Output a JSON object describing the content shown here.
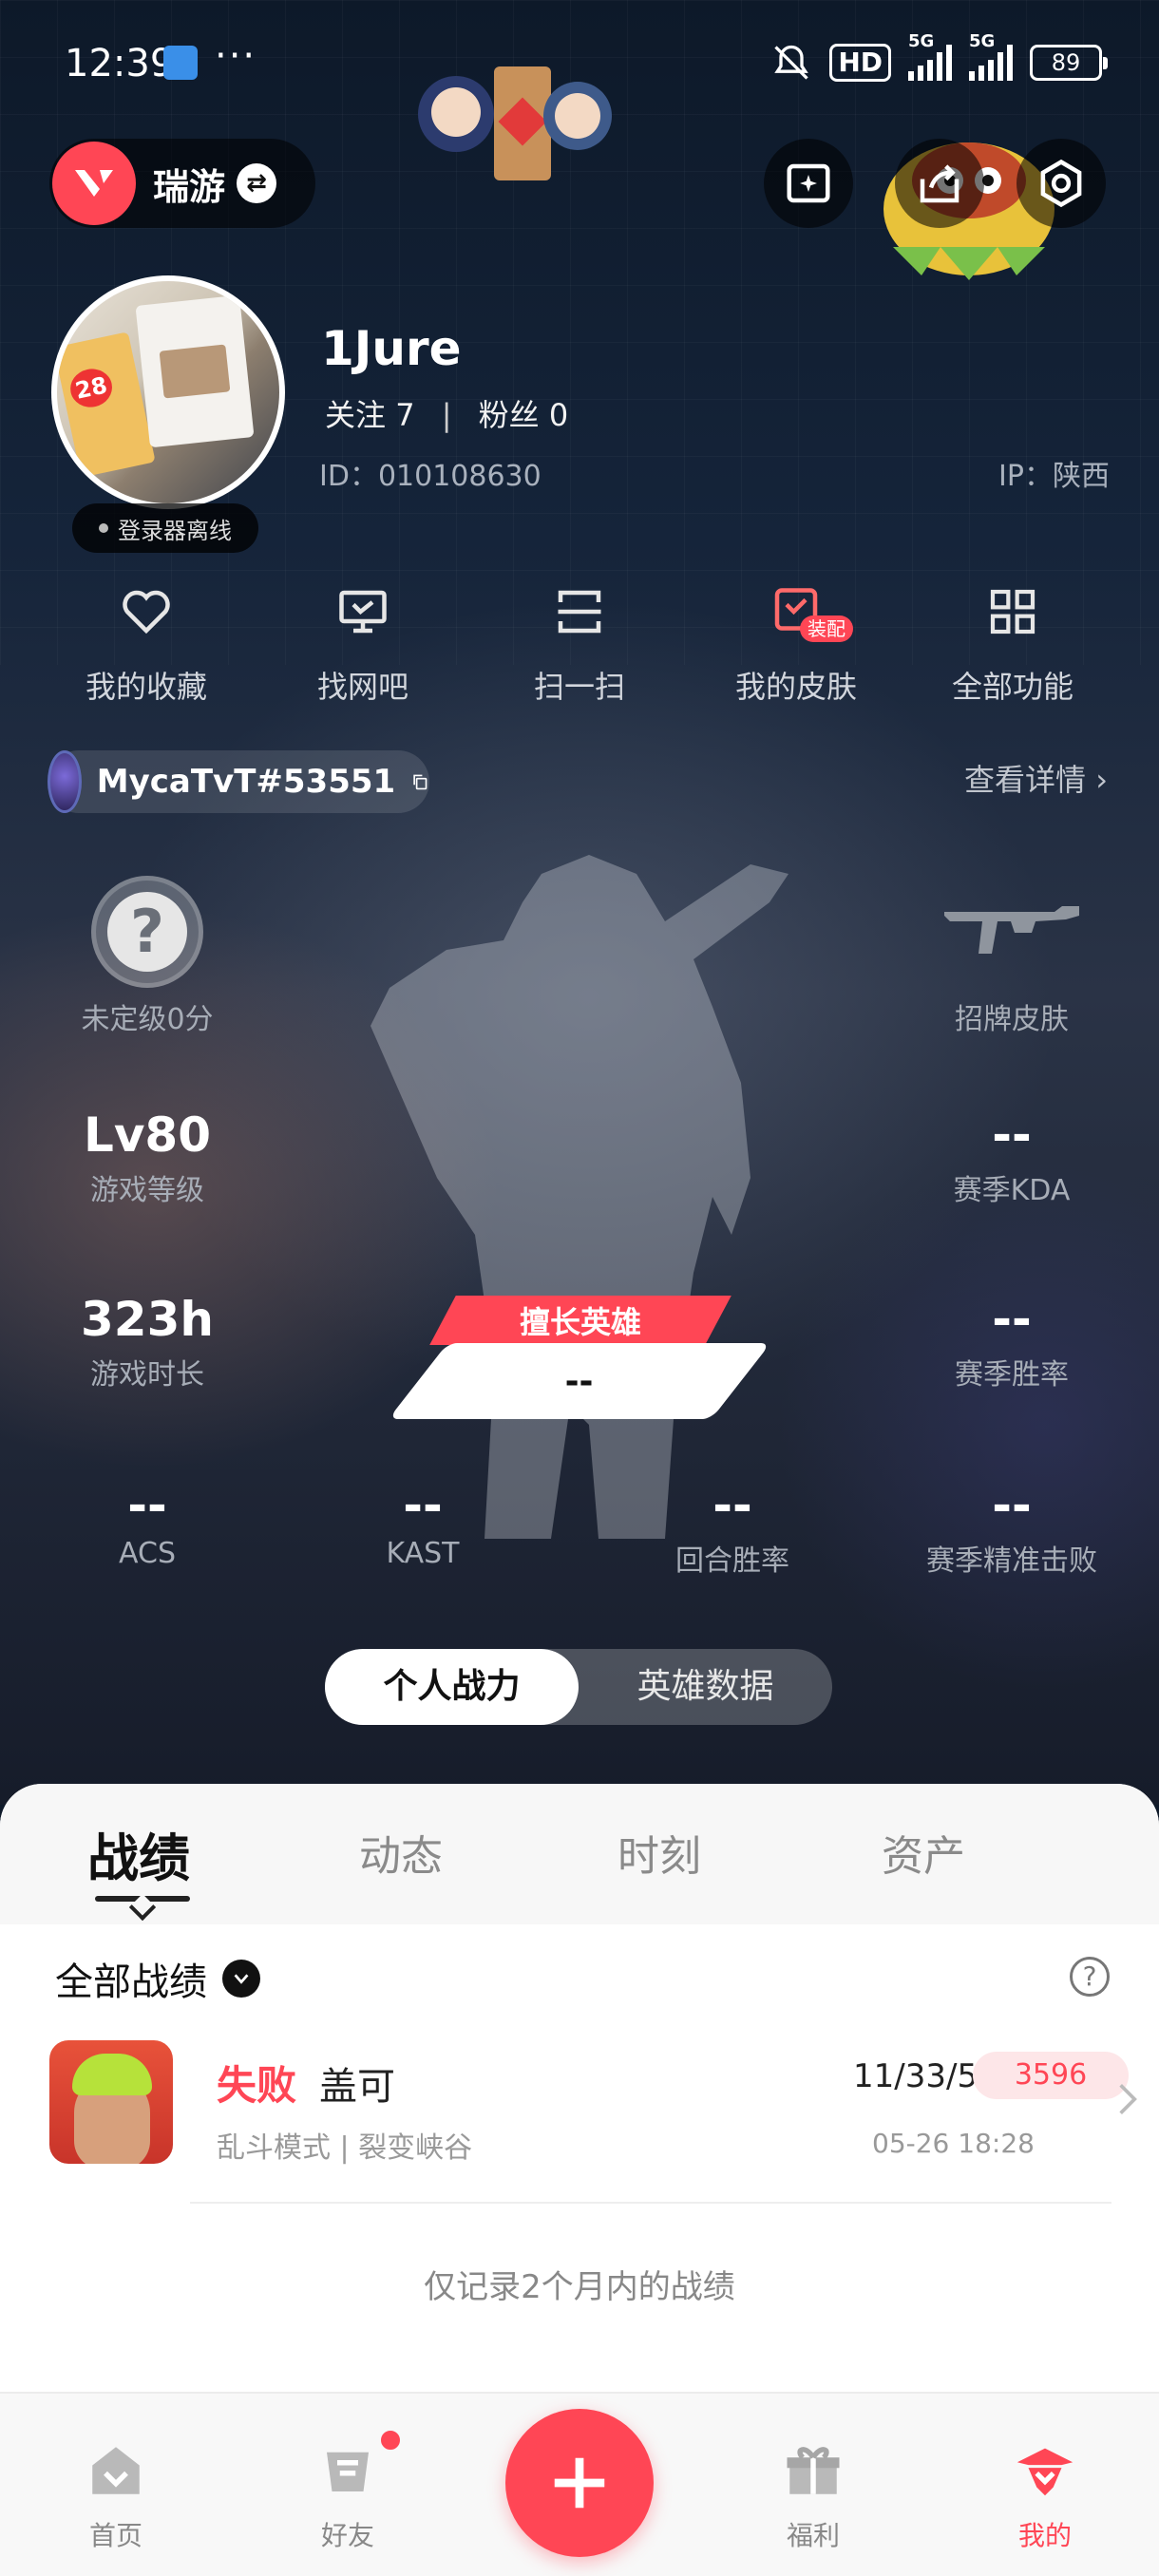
{
  "status_bar": {
    "time": "12:39",
    "dots": "···",
    "hd": "HD",
    "net1": "5G",
    "net2": "5G",
    "battery": "89"
  },
  "top_bar": {
    "app_name": "瑞游",
    "swap_icon": "swap-icon",
    "icons": [
      "gallery-icon",
      "share-icon",
      "settings-icon"
    ]
  },
  "profile": {
    "username": "1Jure",
    "follow_label": "关注",
    "follow_count": "7",
    "fans_label": "粉丝",
    "fans_count": "0",
    "id": "ID：010108630",
    "ip": "IP：陕西",
    "status": "登录器离线"
  },
  "features": [
    {
      "label": "我的收藏",
      "icon": "heart-icon"
    },
    {
      "label": "找网吧",
      "icon": "monitor-icon"
    },
    {
      "label": "扫一扫",
      "icon": "scan-icon"
    },
    {
      "label": "我的皮肤",
      "icon": "skin-icon",
      "badge": "装配"
    },
    {
      "label": "全部功能",
      "icon": "grid-icon"
    }
  ],
  "game_account": {
    "name": "MycaTvT#53551",
    "see_detail": "查看详情"
  },
  "stats": {
    "rank": {
      "label": "未定级0分"
    },
    "skin": {
      "label": "招牌皮肤"
    },
    "level": {
      "value": "Lv80",
      "label": "游戏等级"
    },
    "kda": {
      "value": "--",
      "label": "赛季KDA"
    },
    "hours": {
      "value": "323h",
      "label": "游戏时长"
    },
    "winrate": {
      "value": "--",
      "label": "赛季胜率"
    },
    "best_agent": {
      "title": "擅长英雄",
      "value": "--"
    },
    "acs": {
      "value": "--",
      "label": "ACS"
    },
    "kast": {
      "value": "--",
      "label": "KAST"
    },
    "round_winrate": {
      "value": "--",
      "label": "回合胜率"
    },
    "precise_kill": {
      "value": "--",
      "label": "赛季精准击败"
    }
  },
  "toggle": {
    "options": [
      "个人战力",
      "英雄数据"
    ],
    "active": 0
  },
  "tabs": [
    "战绩",
    "动态",
    "时刻",
    "资产"
  ],
  "filter": {
    "label": "全部战绩",
    "help": "?"
  },
  "matches": [
    {
      "result": "失败",
      "agent": "盖可",
      "mode": "乱斗模式 | 裂变峡谷",
      "kda": "11/33/5",
      "score": "3596",
      "date": "05-26 18:28"
    }
  ],
  "note": "仅记录2个月内的战绩",
  "bottom_nav": [
    {
      "label": "首页",
      "icon": "home-icon"
    },
    {
      "label": "好友",
      "icon": "friends-icon"
    },
    {
      "label": "福利",
      "icon": "gift-icon"
    },
    {
      "label": "我的",
      "icon": "profile-icon"
    }
  ],
  "colors": {
    "accent": "#ff4655",
    "bg_dark": "#0f1a2a"
  }
}
